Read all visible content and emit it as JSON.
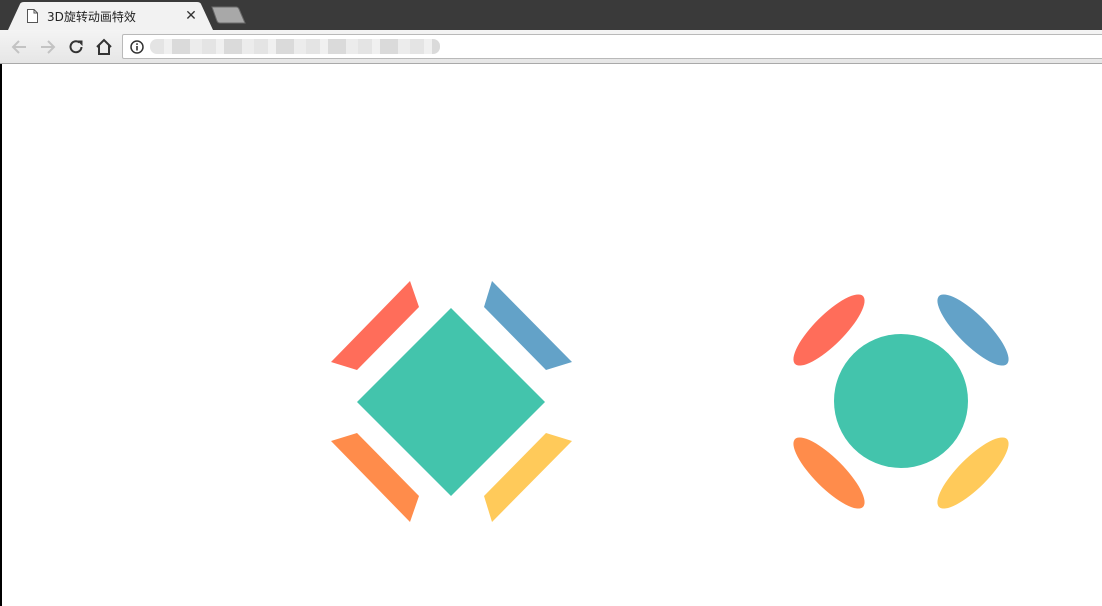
{
  "browser": {
    "tab": {
      "title": "3D旋转动画特效",
      "close_glyph": "✕",
      "favicon": "page-icon"
    },
    "toolbar": {
      "back": "back-arrow-icon",
      "forward": "forward-arrow-icon",
      "reload": "reload-icon",
      "home": "home-icon",
      "info": "info-icon"
    },
    "address_bar": {
      "value": ""
    }
  },
  "demos": [
    {
      "center_shape": "diamond",
      "center_color": "#43c4ac",
      "pieces": [
        "#ff6d5a",
        "#63a2c8",
        "#ff8c4b",
        "#ffca5a"
      ]
    },
    {
      "center_shape": "circle",
      "center_color": "#43c4ac",
      "pieces": [
        "#ff6d5a",
        "#63a2c8",
        "#ff8c4b",
        "#ffca5a"
      ]
    }
  ],
  "colors": {
    "tabstrip": "#3a3a3a",
    "teal": "#43c4ac",
    "red": "#ff6d5a",
    "blue": "#63a2c8",
    "orange": "#ff8c4b",
    "yellow": "#ffca5a"
  }
}
